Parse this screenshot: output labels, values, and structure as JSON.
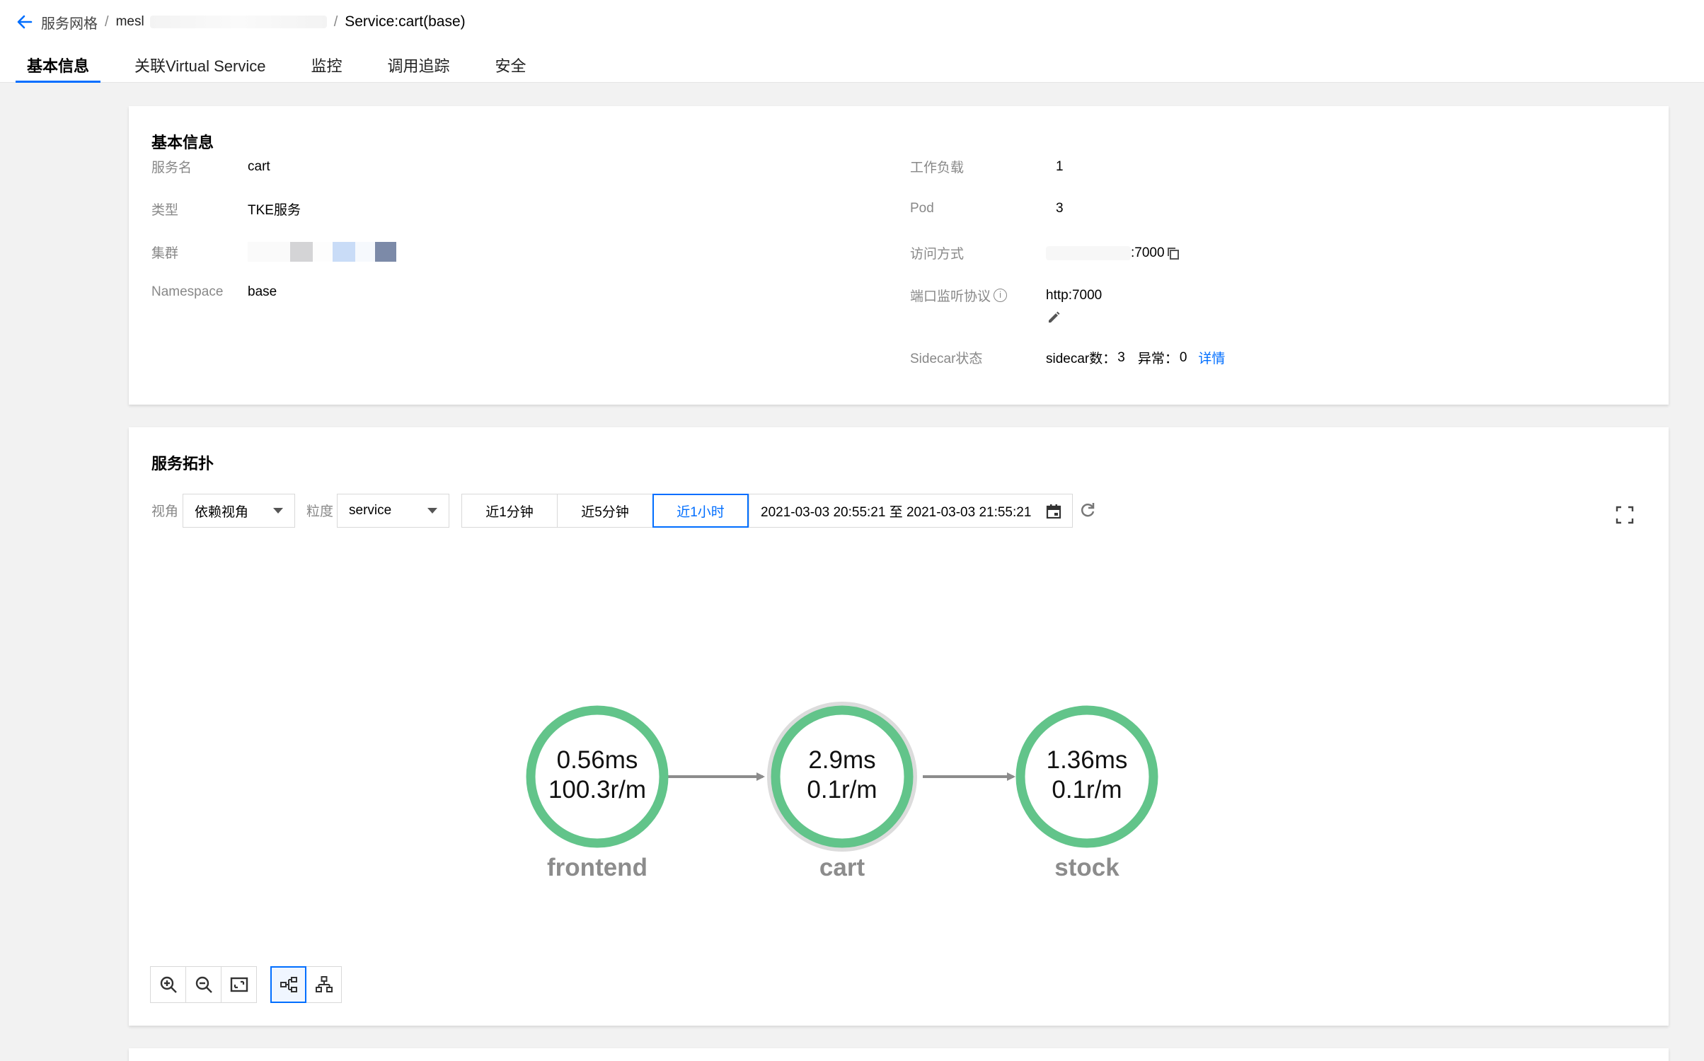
{
  "breadcrumb": {
    "parent": "服务网格",
    "separator": "/",
    "mesh": "mesl",
    "current": "Service:cart(base)"
  },
  "tabs": [
    {
      "label": "基本信息",
      "active": true
    },
    {
      "label": "关联Virtual Service",
      "active": false
    },
    {
      "label": "监控",
      "active": false
    },
    {
      "label": "调用追踪",
      "active": false
    },
    {
      "label": "安全",
      "active": false
    }
  ],
  "basic": {
    "title": "基本信息",
    "left": {
      "service_name_label": "服务名",
      "service_name": "cart",
      "type_label": "类型",
      "type": "TKE服务",
      "cluster_label": "集群",
      "namespace_label": "Namespace",
      "namespace": "base"
    },
    "right": {
      "workload_label": "工作负载",
      "workload": "1",
      "pod_label": "Pod",
      "pod": "3",
      "access_label": "访问方式",
      "access": ":7000",
      "port_label": "端口监听协议",
      "port": "http:7000",
      "sidecar_label": "Sidecar状态",
      "sidecar_count_label": "sidecar数：",
      "sidecar_count": "3",
      "abnormal_label": "异常：",
      "abnormal": "0",
      "detail_link": "详情"
    }
  },
  "topology": {
    "title": "服务拓扑",
    "view_label": "视角",
    "view_value": "依赖视角",
    "granularity_label": "粒度",
    "granularity_value": "service",
    "time_buttons": [
      "近1分钟",
      "近5分钟",
      "近1小时"
    ],
    "time_active_index": 2,
    "date_range": "2021-03-03 20:55:21 至 2021-03-03 21:55:21",
    "nodes": [
      {
        "name": "frontend",
        "latency": "0.56ms",
        "rate": "100.3r/m",
        "selected": false
      },
      {
        "name": "cart",
        "latency": "2.9ms",
        "rate": "0.1r/m",
        "selected": true
      },
      {
        "name": "stock",
        "latency": "1.36ms",
        "rate": "0.1r/m",
        "selected": false
      }
    ],
    "colors": {
      "node_ring": "#62c48a",
      "selected_halo": "#dcdcdc",
      "edge": "#8c8c8c",
      "accent": "#006eff"
    },
    "icons": [
      "zoom-in-icon",
      "zoom-out-icon",
      "fit-view-icon",
      "horizontal-layout-icon",
      "tree-layout-icon"
    ]
  }
}
